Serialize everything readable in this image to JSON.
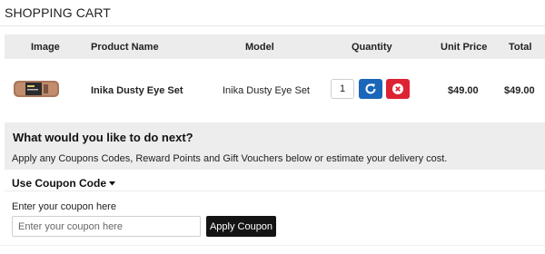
{
  "page": {
    "title": "SHOPPING CART"
  },
  "cart": {
    "columns": [
      "Image",
      "Product Name",
      "Model",
      "Quantity",
      "Unit Price",
      "Total"
    ],
    "items": [
      {
        "product_name": "Inika Dusty Eye Set",
        "model": "Inika Dusty Eye Set",
        "quantity": "1",
        "unit_price": "$49.00",
        "total": "$49.00",
        "image_icon": "product-thumbnail",
        "update_icon": "refresh-icon",
        "remove_icon": "remove-circle-icon"
      }
    ]
  },
  "next_steps": {
    "heading": "What would you like to do next?",
    "description": "Apply any Coupons Codes, Reward Points and Gift Vouchers below or estimate your delivery cost."
  },
  "coupon": {
    "toggle_label": "Use Coupon Code",
    "field_label": "Enter your coupon here",
    "placeholder": "Enter your coupon here",
    "value": "",
    "apply_label": "Apply Coupon"
  },
  "colors": {
    "update_button": "#1a66b8",
    "remove_button": "#dd2233",
    "apply_button": "#141414",
    "header_bg": "#ececec",
    "panel_bg": "#ededed"
  }
}
